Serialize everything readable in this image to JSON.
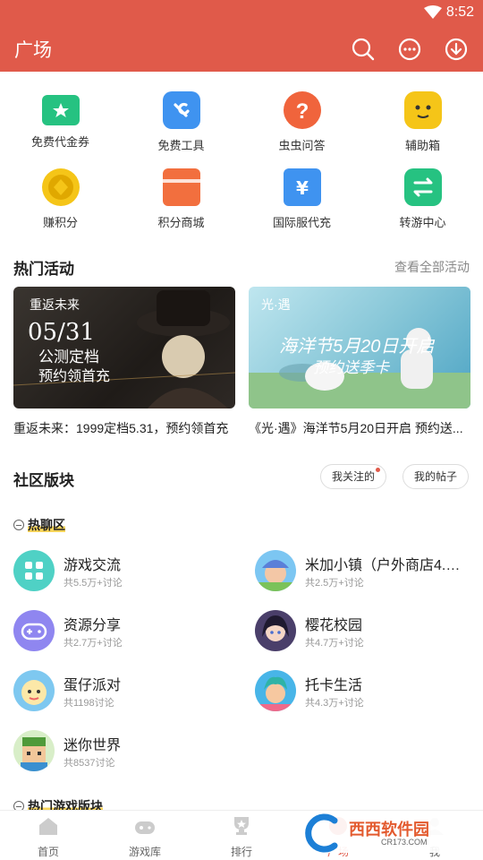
{
  "status_bar": {
    "time": "8:52"
  },
  "header": {
    "title": "广场"
  },
  "quick_grid": [
    {
      "label": "免费代金券",
      "icon": "ticket-icon",
      "color": "#26c281"
    },
    {
      "label": "免费工具",
      "icon": "toolbox-icon",
      "color": "#3f93f0"
    },
    {
      "label": "虫虫问答",
      "icon": "question-icon",
      "color": "#f0643c"
    },
    {
      "label": "辅助箱",
      "icon": "robot-icon",
      "color": "#f5c518"
    },
    {
      "label": "赚积分",
      "icon": "coin-icon",
      "color": "#f5c518"
    },
    {
      "label": "积分商城",
      "icon": "shop-icon",
      "color": "#f26f3e"
    },
    {
      "label": "国际服代充",
      "icon": "wallet-icon",
      "color": "#3f93f0"
    },
    {
      "label": "转游中心",
      "icon": "swap-icon",
      "color": "#26c281"
    }
  ],
  "hot_events": {
    "title": "热门活动",
    "more": "查看全部活动",
    "items": [
      {
        "caption": "重返未来：1999定档5.31，预约领首充",
        "banner_line1": "重返未来",
        "banner_line2": "05/31",
        "banner_line3": "公测定档",
        "banner_line4": "预约领首充"
      },
      {
        "caption": "《光·遇》海洋节5月20日开启 预约送...",
        "banner_line1": "光·遇",
        "banner_line2": "海洋节5月20日开启",
        "banner_line3": "预约送季卡"
      }
    ]
  },
  "community": {
    "title": "社区版块",
    "follow_button": "我关注的",
    "posts_button": "我的帖子",
    "hot_chat_label": "热聊区",
    "hot_games_label": "热门游戏版块",
    "forums": [
      {
        "name": "游戏交流",
        "meta": "共5.5万+讨论",
        "icon": "grid-icon",
        "color": "#4fd1c5"
      },
      {
        "name": "米加小镇（户外商店4.26...",
        "meta": "共2.5万+讨论",
        "icon": "avatar-icon",
        "color": "#7cc6f2"
      },
      {
        "name": "资源分享",
        "meta": "共2.7万+讨论",
        "icon": "gamepad-icon",
        "color": "#8f86f0"
      },
      {
        "name": "樱花校园",
        "meta": "共4.7万+讨论",
        "icon": "avatar-icon",
        "color": "#4a3f6a"
      },
      {
        "name": "蛋仔派对",
        "meta": "共1198讨论",
        "icon": "avatar-icon",
        "color": "#f7d36b"
      },
      {
        "name": "托卡生活",
        "meta": "共4.3万+讨论",
        "icon": "avatar-icon",
        "color": "#48b5e8"
      },
      {
        "name": "迷你世界",
        "meta": "共8537讨论",
        "icon": "avatar-icon",
        "color": "#7ac36a"
      }
    ]
  },
  "bottom_nav": [
    {
      "label": "首页",
      "icon": "home-icon"
    },
    {
      "label": "游戏库",
      "icon": "gamepad-icon"
    },
    {
      "label": "排行",
      "icon": "trophy-icon"
    },
    {
      "label": "广场",
      "icon": "plaza-icon"
    },
    {
      "label": "我",
      "icon": "user-icon"
    }
  ],
  "watermark": {
    "line1": "西西软件园",
    "line2": "CR173.COM"
  },
  "colors": {
    "brand": "#e05a4a"
  }
}
